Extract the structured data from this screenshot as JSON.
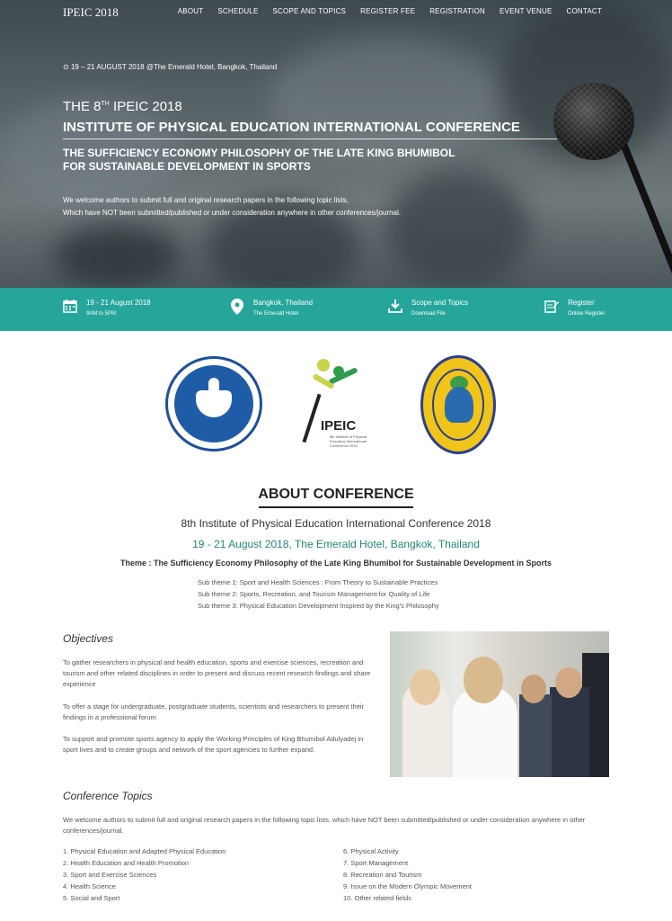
{
  "nav": {
    "brand": "IPEIC 2018",
    "items": [
      "ABOUT",
      "SCHEDULE",
      "SCOPE AND TOPICS",
      "REGISTER FEE",
      "REGISTRATION",
      "EVENT VENUE",
      "CONTACT"
    ]
  },
  "hero": {
    "event_line": "19 – 21 AUGUST 2018 @The Emerald Hotel, Bangkok, Thailand",
    "title_prefix": "THE 8",
    "title_sup": "TH",
    "title_suffix": " IPEIC 2018",
    "title_line2": "INSTITUTE OF PHYSICAL EDUCATION INTERNATIONAL CONFERENCE",
    "subtitle_line1": "THE SUFFICIENCY ECONOMY PHILOSOPHY OF THE LATE KING BHUMIBOL",
    "subtitle_line2": "FOR SUSTAINABLE DEVELOPMENT IN SPORTS",
    "welcome_line1": "We welcome authors to submit full and original research papers in the following topic lists,",
    "welcome_line2": "Which have NOT been submitted/published or under consideration anywhere in other conferences/journal."
  },
  "infobar": {
    "items": [
      {
        "icon": "calendar-icon",
        "line1": "19 - 21 August 2018",
        "line2": "9AM to 5PM"
      },
      {
        "icon": "location-pin-icon",
        "line1": "Bangkok, Thailand",
        "line2": "The Emerald Hotel"
      },
      {
        "icon": "download-icon",
        "line1": "Scope and Topics",
        "line2": "Download File"
      },
      {
        "icon": "register-icon",
        "line1": "Register",
        "line2": "Online Register"
      }
    ]
  },
  "logos": {
    "ipeic_text": "IPEIC",
    "ipeic_small": "8th Institute of Physical Education International Conference 2018"
  },
  "about": {
    "heading": "ABOUT CONFERENCE",
    "conference_name": "8th Institute of Physical Education International Conference 2018",
    "date_venue": "19 - 21 August 2018, The Emerald Hotel, Bangkok, Thailand",
    "theme": "Theme : The Sufficiency Economy Philosophy of the Late King Bhumibol for Sustainable Development in Sports",
    "subthemes": [
      "Sub theme 1: Sport and Health Sciences : From Theory to Sustainable Practices",
      "Sub theme 2: Sports, Recreation, and Tourism Management for Quality of Life",
      "Sub theme 3: Physical Education Development Inspired by the King's Philosophy"
    ]
  },
  "objectives": {
    "heading": "Objectives",
    "paragraphs": [
      "To gather researchers in physical and health education, sports and exercise sciences, recreation and tourism and other related disciplines in order to present and discuss recent research findings and share experience",
      "To offer a stage for undergraduate, postgraduate students, scientists and researchers to present their findings in a professional forum",
      "To support and promote sports agency to apply the Working Principles of King Bhumibol Adulyadej in sport lives and to create groups and network of the sport agencies to further expand."
    ]
  },
  "topics": {
    "heading": "Conference Topics",
    "intro": "We welcome authors to submit full and original research papers in the following topic lists, which have NOT been submitted/published or under consideration anywhere in other conferences/journal.",
    "left": [
      "1. Physical Education and Adapted Physical Education",
      "2. Health Education and Health Promotion",
      "3. Sport and Exercise Sciences",
      "4. Health Science",
      "5. Social and Sport"
    ],
    "right": [
      "6. Physical Activity",
      "7. Sport Management",
      "8. Recreation and Tourism",
      "9. Issue on the Modern Olympic Movement",
      "10. Other related fields"
    ]
  }
}
